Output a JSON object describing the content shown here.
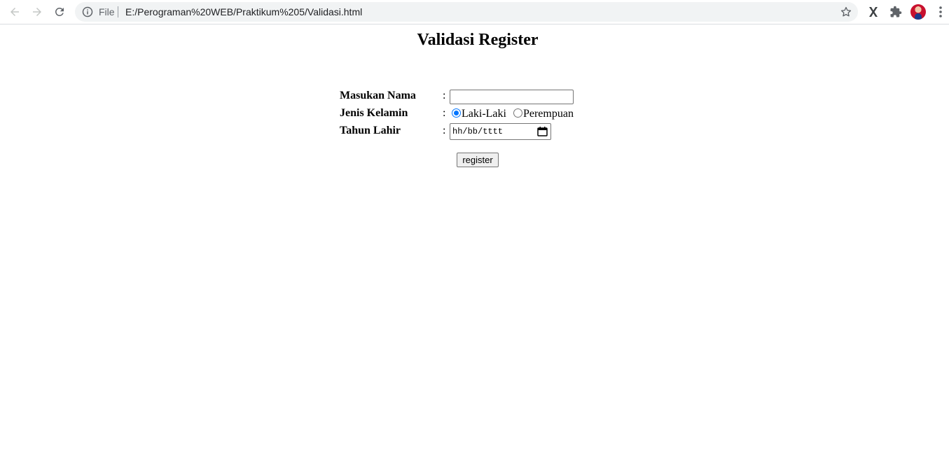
{
  "browser": {
    "file_label": "File",
    "url": "E:/Perograman%20WEB/Praktikum%205/Validasi.html",
    "icons": [
      "back-arrow-icon",
      "forward-arrow-icon",
      "reload-icon",
      "info-icon",
      "star-icon",
      "x-extension-icon",
      "puzzle-icon",
      "avatar",
      "kebab-menu-icon"
    ]
  },
  "page": {
    "title": "Validasi Register",
    "fields": {
      "name_label": "Masukan Nama",
      "gender_label": "Jenis Kelamin",
      "birth_label": "Tahun Lahir",
      "colon": ":",
      "name_value": "",
      "gender_options": [
        "Laki-Laki",
        "Perempuan"
      ],
      "gender_selected": "Laki-Laki",
      "date_placeholder": "hh/bb/tttt"
    },
    "register_label": "register"
  },
  "colors": {
    "radio_checked": "#0075ff",
    "omnibox_bg": "#f1f3f4"
  }
}
